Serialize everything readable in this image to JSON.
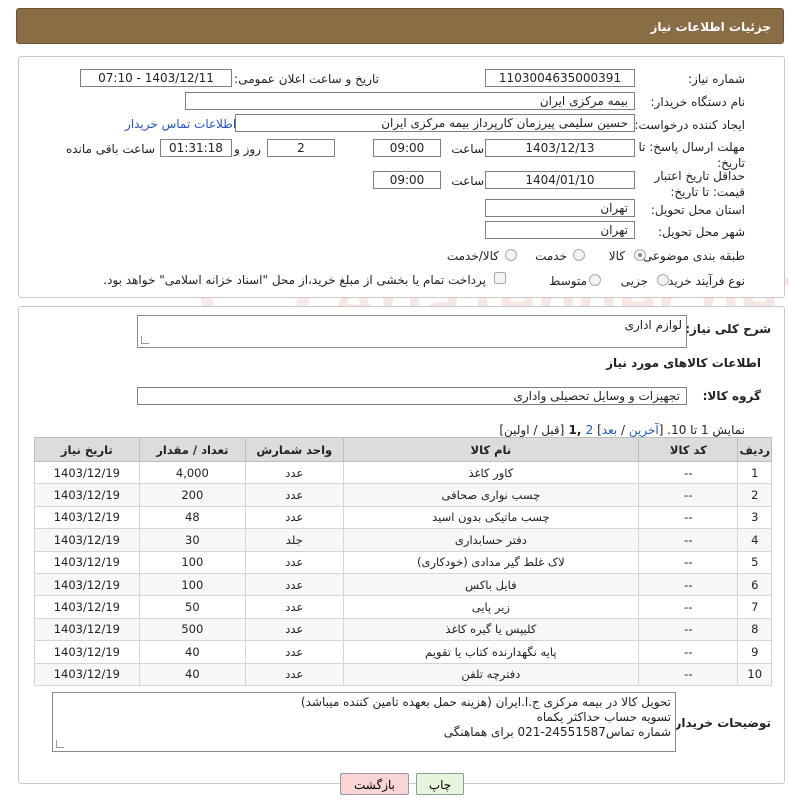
{
  "header": {
    "title": "جزئیات اطلاعات نیاز"
  },
  "form": {
    "need_number_label": "شماره نیاز:",
    "need_number": "1103004635000391",
    "announce_label": "تاریخ و ساعت اعلان عمومی:",
    "announce_value": "1403/12/11 - 07:10",
    "buyer_org_label": "نام دستگاه خریدار:",
    "buyer_org": "بیمه مرکزی ایران",
    "creator_label": "ایجاد کننده درخواست:",
    "creator": "حسین سلیمی پیرزمان کارپرداز بیمه مرکزی ایران",
    "contact_link": "اطلاعات تماس خریدار",
    "deadline_label": "مهلت ارسال پاسخ: تا تاریخ:",
    "deadline_date": "1403/12/13",
    "time_label": "ساعت",
    "deadline_time": "09:00",
    "days_value": "2",
    "days_label": "روز و",
    "remaining_value": "01:31:18",
    "remaining_label": "ساعت باقی مانده",
    "validity_label": "حداقل تاریخ اعتبار قیمت: تا تاریخ:",
    "validity_date": "1404/01/10",
    "validity_time": "09:00",
    "province_label": "استان محل تحویل:",
    "province": "تهران",
    "city_label": "شهر محل تحویل:",
    "city": "تهران",
    "category_label": "طبقه بندی موضوعی:",
    "category_options": [
      "کالا",
      "خدمت",
      "کالا/خدمت"
    ],
    "process_label": "نوع فرآیند خرید :",
    "process_options": [
      "جزیی",
      "متوسط"
    ],
    "payment_note": "پرداخت تمام یا بخشی از مبلغ خرید،از محل \"اسناد خزانه اسلامی\" خواهد بود."
  },
  "details": {
    "summary_label": "شرح کلی نیاز:",
    "summary_value": "لوازم اداری",
    "items_title": "اطلاعات کالاهای مورد نیاز",
    "group_label": "گروه کالا:",
    "group_value": "تجهیزات و وسایل تحصیلی واداری",
    "pager_prefix": "نمایش 1 تا 10. [",
    "pager_last": "آخرین",
    "pager_sep1": " / ",
    "pager_next": "بعد",
    "pager_sep2": "] ",
    "pager_page2": "2",
    "pager_page1": " ,1 ",
    "pager_suffix": "[قبل / اولین]"
  },
  "table": {
    "headers": [
      "ردیف",
      "کد کالا",
      "نام کالا",
      "واحد شمارش",
      "تعداد / مقدار",
      "تاریخ نیاز"
    ],
    "rows": [
      [
        "1",
        "--",
        "کاور کاغذ",
        "عدد",
        "4,000",
        "1403/12/19"
      ],
      [
        "2",
        "--",
        "چسب نواری صحافی",
        "عدد",
        "200",
        "1403/12/19"
      ],
      [
        "3",
        "--",
        "چسب ماتیکی بدون اسید",
        "عدد",
        "48",
        "1403/12/19"
      ],
      [
        "4",
        "--",
        "دفتر حسابداری",
        "جلد",
        "30",
        "1403/12/19"
      ],
      [
        "5",
        "--",
        "لاک غلط گیر مدادی (خودکاری)",
        "عدد",
        "100",
        "1403/12/19"
      ],
      [
        "6",
        "--",
        "فایل باکس",
        "عدد",
        "100",
        "1403/12/19"
      ],
      [
        "7",
        "--",
        "زیر پایی",
        "عدد",
        "50",
        "1403/12/19"
      ],
      [
        "8",
        "--",
        "کلیپس یا گیره کاغذ",
        "عدد",
        "500",
        "1403/12/19"
      ],
      [
        "9",
        "--",
        "پایه نگهدارنده کتاب یا تقویم",
        "عدد",
        "40",
        "1403/12/19"
      ],
      [
        "10",
        "--",
        "دفترچه تلفن",
        "عدد",
        "40",
        "1403/12/19"
      ]
    ]
  },
  "buyer_notes": {
    "label": "توضیحات خریدار:",
    "line1": "تحویل کالا در بیمه مرکزی ج.ا.ایران (هزینه حمل بعهده تامین کننده میباشد)",
    "line2": "تسویه حساب حداکثر یکماه",
    "line3": "شماره تماس24551587-021 برای هماهنگی"
  },
  "buttons": {
    "print": "چاپ",
    "back": "بازگشت"
  },
  "watermark": {
    "text": "AriaTender.neT"
  },
  "colors": {
    "header_bg": "#8a6c45",
    "link": "#2455c3",
    "back_button": "#f9d5d5",
    "print_button": "#e5f6dd"
  }
}
